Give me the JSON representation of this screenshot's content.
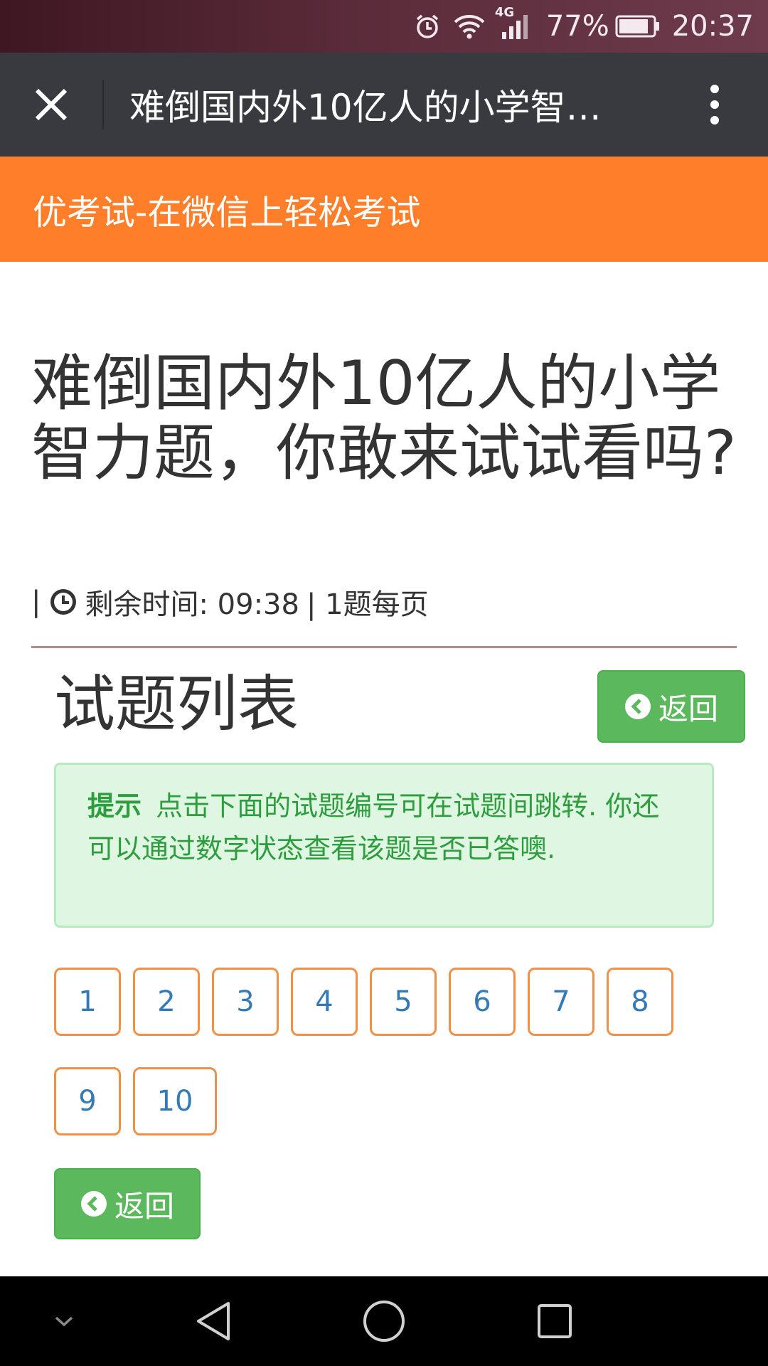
{
  "status_bar": {
    "network": "4G",
    "battery_percent": "77%",
    "time": "20:37",
    "icons": [
      "alarm-icon",
      "wifi-icon",
      "signal-icon",
      "battery-icon"
    ]
  },
  "title_bar": {
    "title": "难倒国内外10亿人的小学智…",
    "icons": [
      "close-icon",
      "more-vertical-icon"
    ]
  },
  "banner": {
    "text": "优考试-在微信上轻松考试"
  },
  "quiz": {
    "title": "难倒国内外10亿人的小学智力题，你敢来试试看吗?",
    "meta_prefix": "|",
    "remaining_label": "剩余时间: 09:38",
    "meta_suffix": "| 1题每页"
  },
  "section": {
    "title": "试题列表",
    "back_label": "返回"
  },
  "tip": {
    "label": "提示",
    "text": "点击下面的试题编号可在试题间跳转. 你还可以通过数字状态查看该题是否已答噢."
  },
  "questions": [
    "1",
    "2",
    "3",
    "4",
    "5",
    "6",
    "7",
    "8",
    "9",
    "10"
  ],
  "bottom_back_label": "返回",
  "nav_bar": {
    "icons": [
      "hide-chevron-icon",
      "back-triangle-icon",
      "home-circle-icon",
      "recents-square-icon"
    ]
  },
  "colors": {
    "banner": "#ff7e2a",
    "title_bar": "#393a3f",
    "success": "#5cb85c",
    "tip_bg": "#dff7e2",
    "tip_text": "#2e9d3e",
    "question_border": "#f0914a",
    "question_text": "#337ab7"
  }
}
